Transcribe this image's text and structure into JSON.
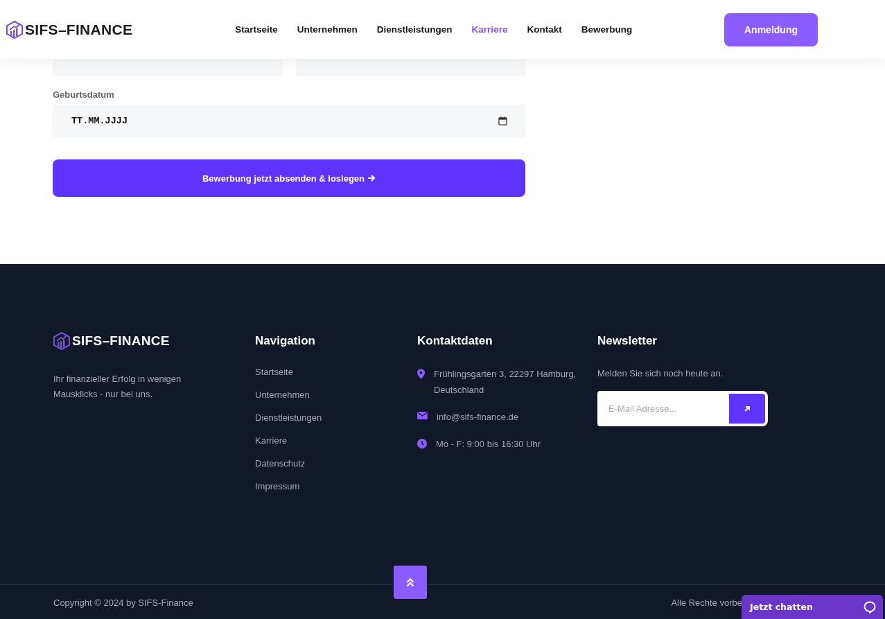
{
  "header": {
    "logo": "SIFS–FINANCE",
    "nav": [
      {
        "label": "Startseite",
        "selected": false
      },
      {
        "label": "Unternehmen",
        "selected": false
      },
      {
        "label": "Dienstleistungen",
        "selected": false
      },
      {
        "label": "Karriere",
        "selected": true
      },
      {
        "label": "Kontakt",
        "selected": false
      },
      {
        "label": "Bewerbung",
        "selected": false
      }
    ],
    "login_button": "Anmeldung"
  },
  "form": {
    "birth_label": "Geburtsdatum",
    "birth_field": {
      "value": "TT.MM.JJJJ"
    },
    "submit_button": "Bewerbung jetzt absenden & loslegen"
  },
  "footer": {
    "logo": "SIFS–FINANCE",
    "tagline": "Ihr finanzieller Erfolg in wenigen Mausklicks - nur bei uns.",
    "navigation": {
      "title": "Navigation",
      "links": [
        "Startseite",
        "Unternehmen",
        "Dienstleistungen",
        "Karriere",
        "Datenschutz",
        "Impressum"
      ]
    },
    "contact": {
      "title": "Kontaktdaten",
      "items": [
        {
          "kind": "location",
          "text": "Frühlingsgarten 3, 22297 Hamburg, Deutschland"
        },
        {
          "kind": "email",
          "text": "info@sifs-finance.de"
        },
        {
          "kind": "hours",
          "text": "Mo - F: 9:00 bis 16:30 Uhr"
        }
      ]
    },
    "newsletter": {
      "title": "Newsletter",
      "text": "Melden Sie sich noch heute an.",
      "placeholder": "E-Mail Adresse..."
    },
    "copyright": "Copyright © 2024 by SIFS-Finance",
    "rights": "Alle Rechte vorbe"
  },
  "chat_widget": {
    "label": "Jetzt chatten"
  }
}
